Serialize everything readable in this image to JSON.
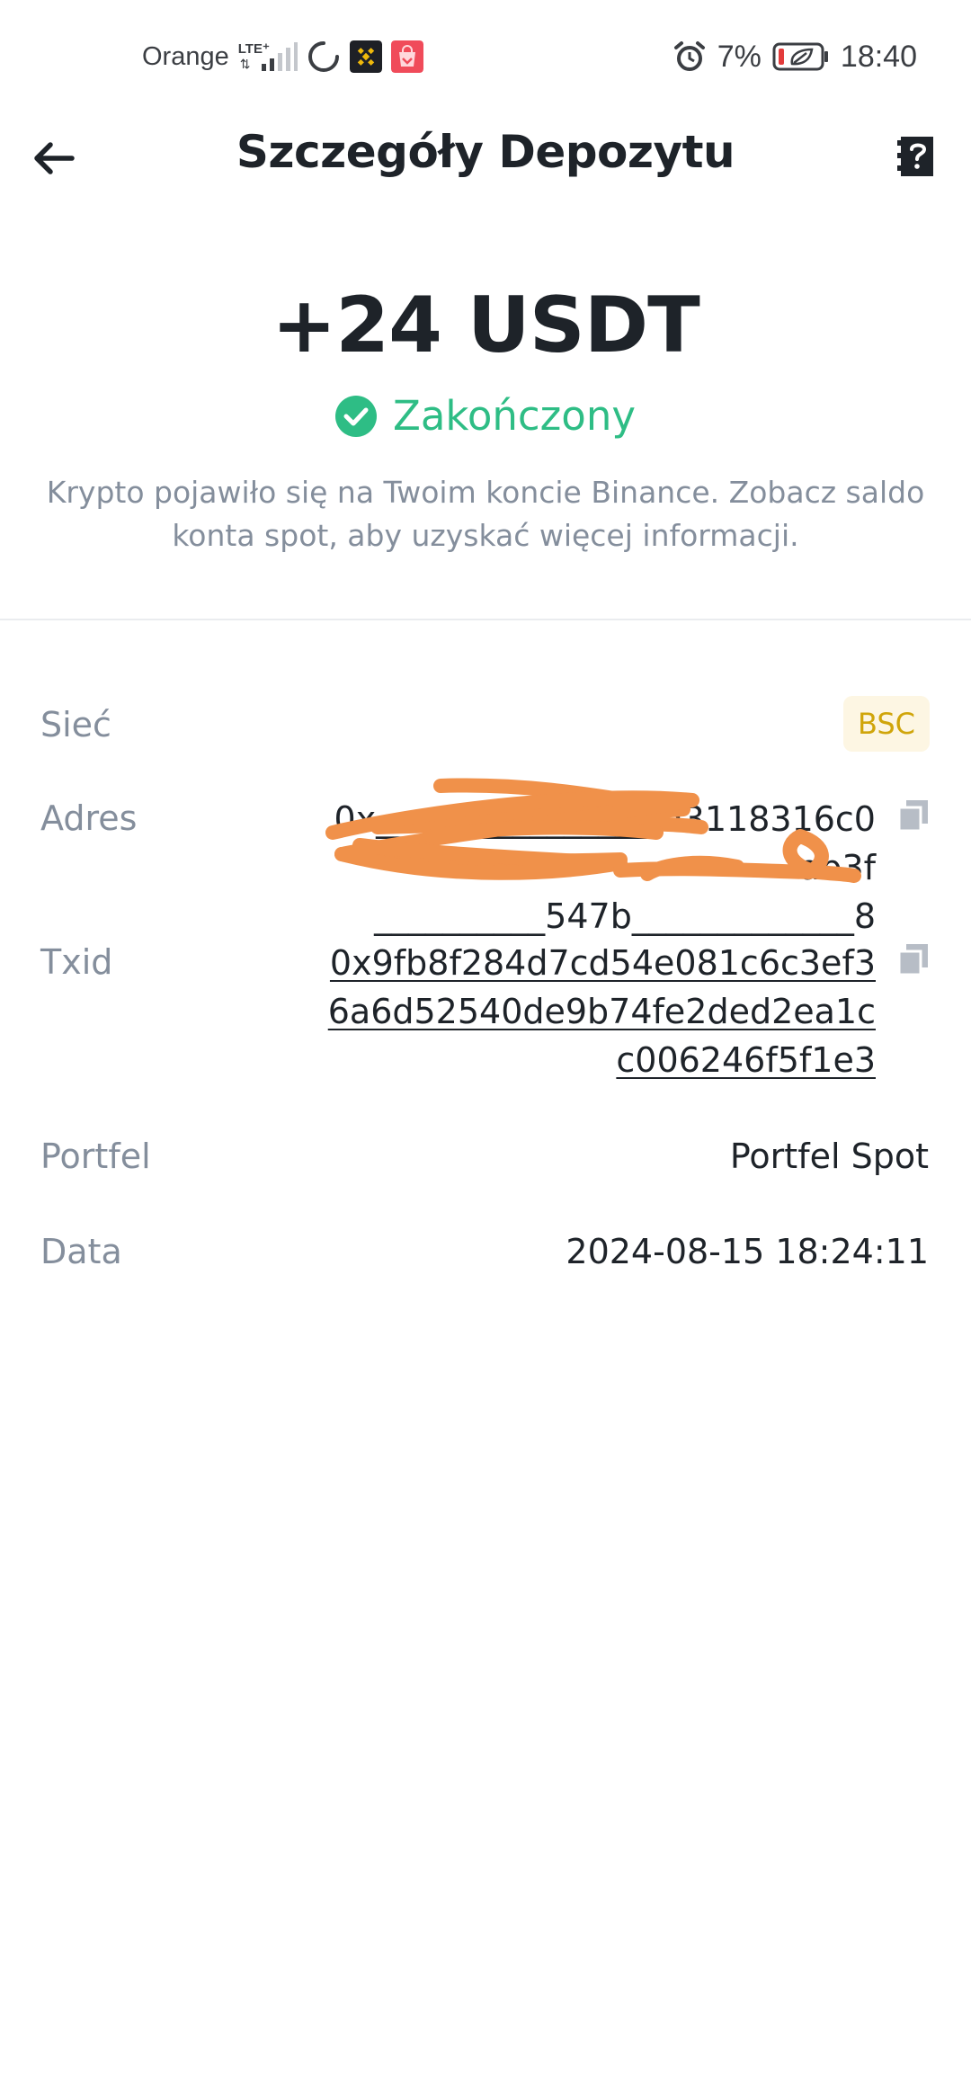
{
  "status_bar": {
    "carrier": "Orange",
    "network": "LTE⁺",
    "battery": "7%",
    "time": "18:40"
  },
  "header": {
    "title": "Szczegóły Depozytu",
    "back_icon": "arrow-left-icon",
    "help_icon": "help-document-icon"
  },
  "deposit": {
    "amount": "+24 USDT",
    "status": "Zakończony",
    "status_color": "#2ebd85",
    "description": "Krypto pojawiło się na Twoim koncie Binance. Zobacz saldo konta spot, aby uzyskać więcej informacji."
  },
  "details": {
    "network": {
      "label": "Sieć",
      "value": "BSC"
    },
    "address": {
      "label": "Adres",
      "value": "0x________________fd3118316c0ab3f\n__________547b_____________8"
    },
    "txid": {
      "label": "Txid",
      "value": "0x9fb8f284d7cd54e081c6c3ef36a6d52540de9b74fe2ded2ea1cc006246f5f1e3"
    },
    "wallet": {
      "label": "Portfel",
      "value": "Portfel Spot"
    },
    "date": {
      "label": "Data",
      "value": "2024-08-15 18:24:11"
    }
  },
  "colors": {
    "accent_yellow": "#d0a50a",
    "text_primary": "#1e2329",
    "text_secondary": "#848e9c",
    "redaction": "#f0914a"
  }
}
